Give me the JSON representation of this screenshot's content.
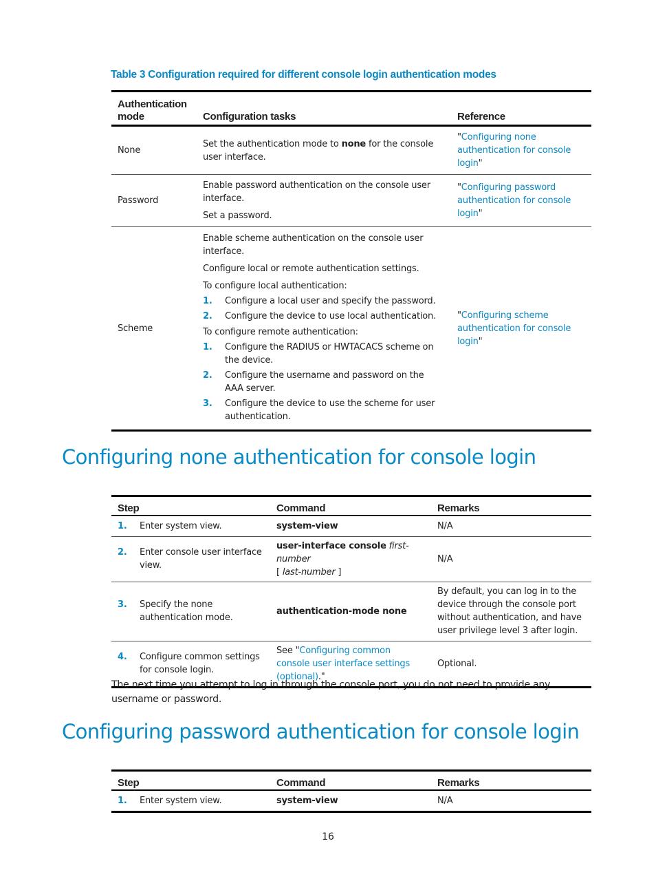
{
  "table3": {
    "caption": "Table 3 Configuration required for different console login authentication modes",
    "headers": [
      "Authentication mode",
      "Configuration tasks",
      "Reference"
    ],
    "rows": [
      {
        "mode": "None",
        "tasks_pre": "Set the authentication mode to ",
        "tasks_bold": "none",
        "tasks_post": " for the console user interface.",
        "ref_open": "\"",
        "ref_link": "Configuring none authentication for console login",
        "ref_close": "\""
      },
      {
        "mode": "Password",
        "tasks": [
          "Enable password authentication on the console user interface.",
          "Set a password."
        ],
        "ref_open": "\"",
        "ref_link": "Configuring password authentication for console login",
        "ref_close": "\""
      },
      {
        "mode": "Scheme",
        "tasks": [
          "Enable scheme authentication on the console user interface.",
          "Configure local or remote authentication settings."
        ],
        "local_intro": "To configure local authentication:",
        "local_steps": [
          {
            "num": "1.",
            "text": "Configure a local user and specify the password."
          },
          {
            "num": "2.",
            "text": "Configure the device to use local authentication."
          }
        ],
        "remote_intro": "To configure remote authentication:",
        "remote_steps": [
          {
            "num": "1.",
            "text": "Configure the RADIUS or HWTACACS scheme on the device."
          },
          {
            "num": "2.",
            "text": "Configure the username and password on the AAA server."
          },
          {
            "num": "3.",
            "text": "Configure the device to use the scheme for user authentication."
          }
        ],
        "ref_open": "\"",
        "ref_link": "Configuring scheme authentication for console login",
        "ref_close": "\""
      }
    ]
  },
  "section_none": {
    "title": "Configuring none authentication for console login",
    "headers": [
      "Step",
      "Command",
      "Remarks"
    ],
    "rows": [
      {
        "num": "1.",
        "step": "Enter system view.",
        "cmd_bold": "system-view",
        "remarks": "N/A"
      },
      {
        "num": "2.",
        "step": "Enter console user interface view.",
        "cmd_bold": "user-interface console",
        "cmd_italic1": "first-number",
        "cmd_bracket_open": "[ ",
        "cmd_italic2": "last-number",
        "cmd_bracket_close": " ]",
        "remarks": "N/A"
      },
      {
        "num": "3.",
        "step": "Specify the none authentication mode.",
        "cmd_bold": "authentication-mode none",
        "remarks": "By default, you can log in to the device through the console port without authentication, and have user privilege level 3 after login."
      },
      {
        "num": "4.",
        "step": "Configure common settings for console login.",
        "cmd_pre": "See \"",
        "cmd_link": "Configuring common console user interface settings (optional)",
        "cmd_post": ".\"",
        "remarks": "Optional."
      }
    ],
    "note": "The next time you attempt to log in through the console port, you do not need to provide any username or password."
  },
  "section_password": {
    "title": "Configuring password authentication for console login",
    "headers": [
      "Step",
      "Command",
      "Remarks"
    ],
    "rows": [
      {
        "num": "1.",
        "step": "Enter system view.",
        "cmd_bold": "system-view",
        "remarks": "N/A"
      }
    ]
  },
  "footer": {
    "page_number": "16"
  },
  "colors": {
    "accent": "#0a8ac5",
    "text": "#222222",
    "rule": "#000000"
  }
}
